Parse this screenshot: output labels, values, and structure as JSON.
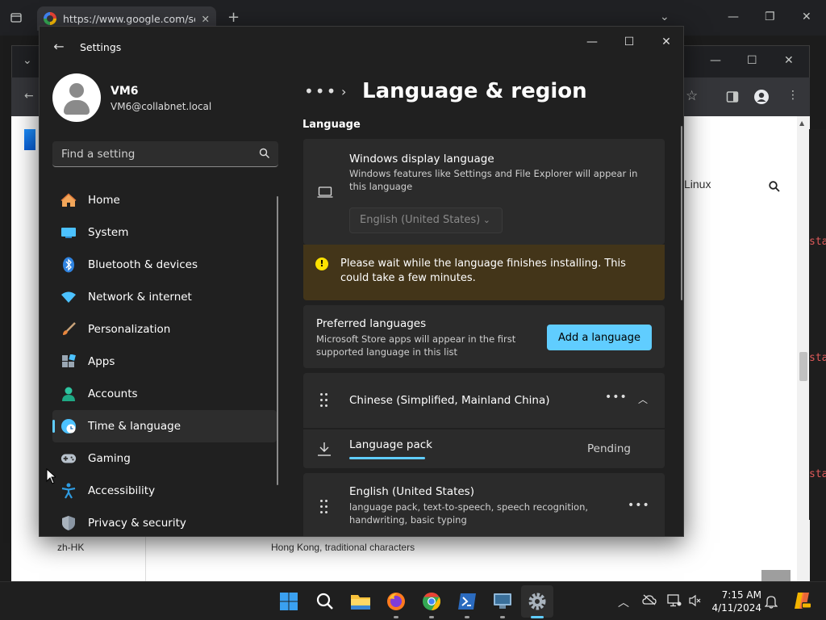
{
  "browser": {
    "tab_title": "https://www.google.com/sear",
    "page_nav_link": "Linux",
    "code_fragments": [
      "sta",
      "sta",
      "sta"
    ],
    "table_row": {
      "code": "zh-HK",
      "name": "Hong Kong, traditional characters"
    }
  },
  "settings": {
    "app_title": "Settings",
    "user": {
      "name": "VM6",
      "email": "VM6@collabnet.local"
    },
    "search_placeholder": "Find a setting",
    "nav": [
      {
        "label": "Home",
        "icon": "home-icon"
      },
      {
        "label": "System",
        "icon": "system-icon"
      },
      {
        "label": "Bluetooth & devices",
        "icon": "bluetooth-icon"
      },
      {
        "label": "Network & internet",
        "icon": "wifi-icon"
      },
      {
        "label": "Personalization",
        "icon": "brush-icon"
      },
      {
        "label": "Apps",
        "icon": "apps-icon"
      },
      {
        "label": "Accounts",
        "icon": "accounts-icon"
      },
      {
        "label": "Time & language",
        "icon": "time-language-icon",
        "active": true
      },
      {
        "label": "Gaming",
        "icon": "gaming-icon"
      },
      {
        "label": "Accessibility",
        "icon": "accessibility-icon"
      },
      {
        "label": "Privacy & security",
        "icon": "shield-icon"
      }
    ],
    "breadcrumb_more": "•••",
    "page_title": "Language & region",
    "section_language": "Language",
    "display_language": {
      "title": "Windows display language",
      "description": "Windows features like Settings and File Explorer will appear in this language",
      "selected": "English (United States)"
    },
    "warning": "Please wait while the language finishes installing. This could take a few minutes.",
    "preferred": {
      "title": "Preferred languages",
      "description": "Microsoft Store apps will appear in the first supported language in this list",
      "add_button": "Add a language"
    },
    "languages": [
      {
        "name": "Chinese (Simplified, Mainland China)"
      },
      {
        "name": "English (United States)",
        "features": "language pack, text-to-speech, speech recognition, handwriting, basic typing"
      }
    ],
    "language_pack": {
      "label": "Language pack",
      "status": "Pending"
    }
  },
  "taskbar": {
    "time": "7:15 AM",
    "date": "4/11/2024",
    "colors": {
      "accent": "#60cdff",
      "warning_bg": "#433519"
    }
  }
}
